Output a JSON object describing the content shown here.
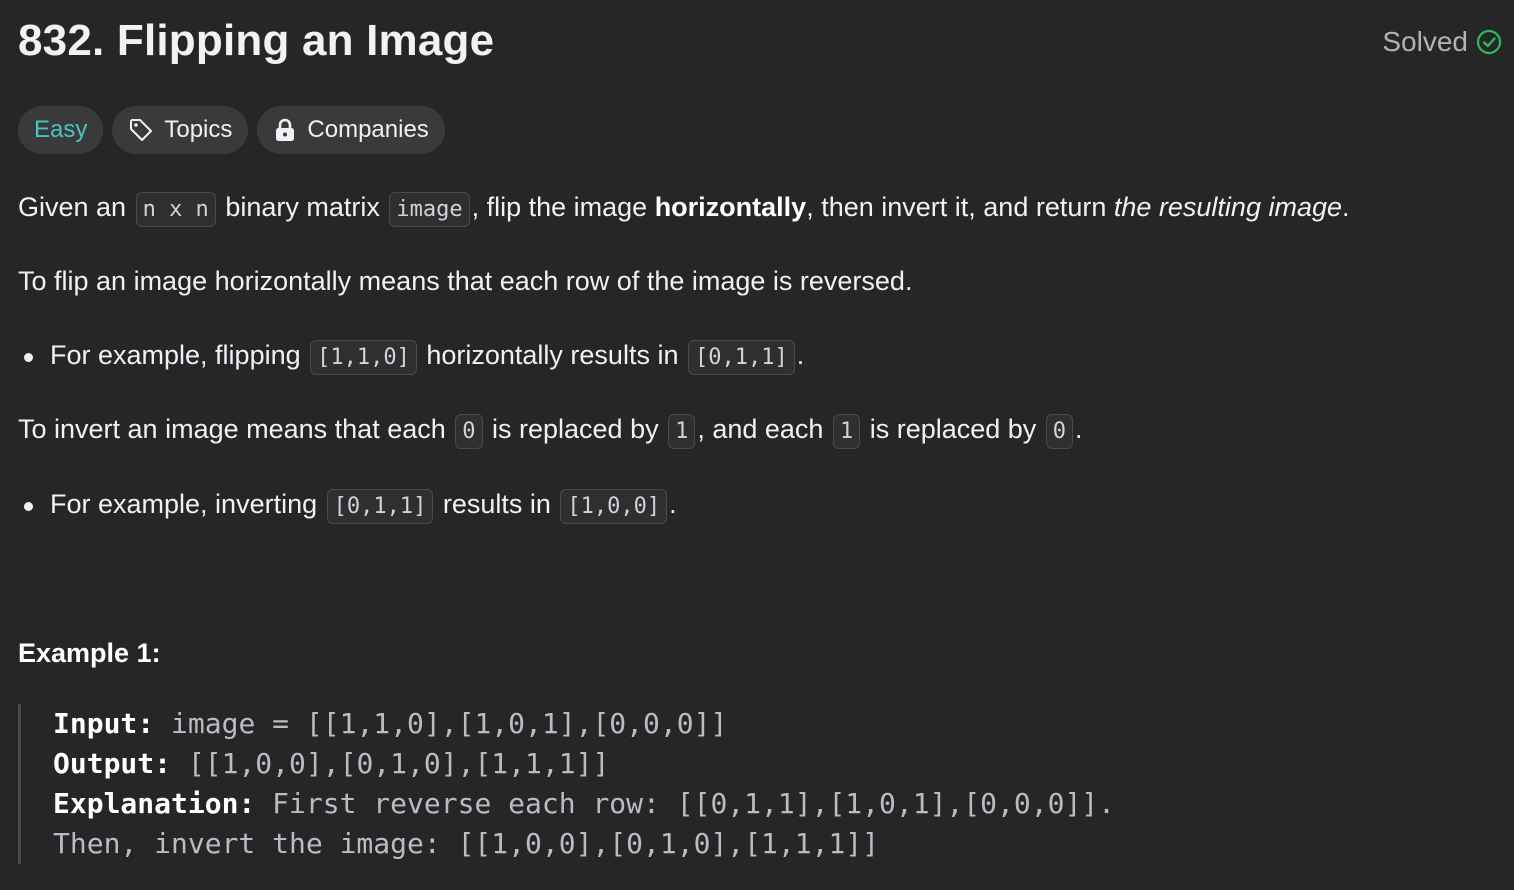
{
  "header": {
    "title": "832. Flipping an Image",
    "status": "Solved",
    "status_color": "#2cbb5d"
  },
  "tags": {
    "difficulty": "Easy",
    "difficulty_color": "#46c6c2",
    "topics": "Topics",
    "companies": "Companies"
  },
  "description": {
    "p1": {
      "t1": "Given an ",
      "c1": "n x n",
      "t2": " binary matrix ",
      "c2": "image",
      "t3": ", flip the image ",
      "b1": "horizontally",
      "t4": ", then invert it, and return ",
      "i1": "the resulting image",
      "t5": "."
    },
    "p2": "To flip an image horizontally means that each row of the image is reversed.",
    "bullet1": {
      "t1": "For example, flipping ",
      "c1": "[1,1,0]",
      "t2": " horizontally results in ",
      "c2": "[0,1,1]",
      "t3": "."
    },
    "p3": {
      "t1": "To invert an image means that each ",
      "c1": "0",
      "t2": " is replaced by ",
      "c2": "1",
      "t3": ", and each ",
      "c3": "1",
      "t4": " is replaced by ",
      "c4": "0",
      "t5": "."
    },
    "bullet2": {
      "t1": "For example, inverting ",
      "c1": "[0,1,1]",
      "t2": " results in ",
      "c2": "[1,0,0]",
      "t3": "."
    }
  },
  "example1": {
    "title": "Example 1:",
    "input_label": "Input:",
    "input_value": " image = [[1,1,0],[1,0,1],[0,0,0]]",
    "output_label": "Output:",
    "output_value": " [[1,0,0],[0,1,0],[1,1,1]]",
    "explanation_label": "Explanation:",
    "explanation_value": " First reverse each row: [[0,1,1],[1,0,1],[0,0,0]].",
    "explanation_line2": "Then, invert the image: [[1,0,0],[0,1,0],[1,1,1]]"
  }
}
